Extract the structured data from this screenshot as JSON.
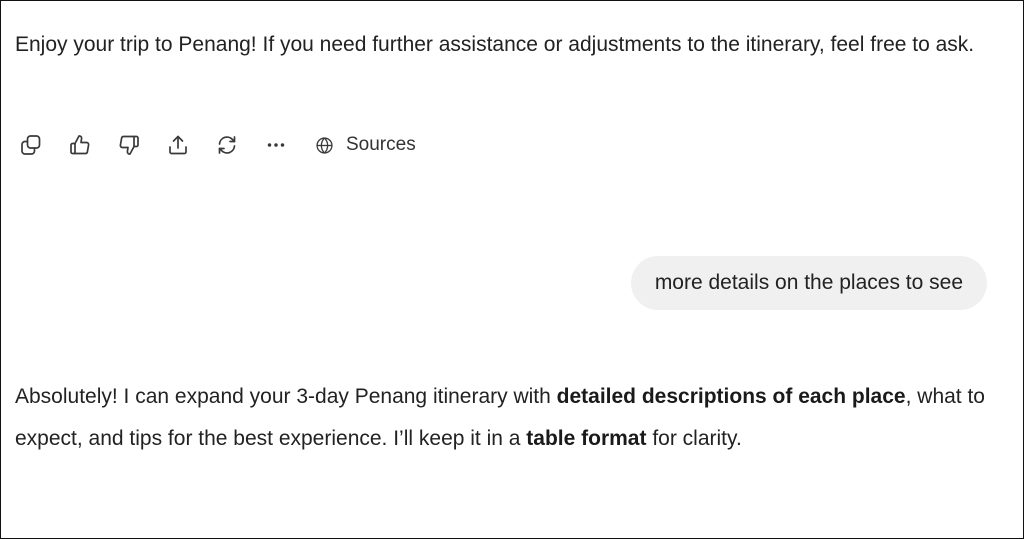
{
  "messages": [
    {
      "role": "assistant",
      "text": "Enjoy your trip to Penang! If you need further assistance or adjustments to the itinerary, feel free to ask."
    },
    {
      "role": "user",
      "text": "more details on the places to see"
    },
    {
      "role": "assistant",
      "segments": {
        "s1": "Absolutely! I can expand your 3-day Penang itinerary with ",
        "s2": "detailed descriptions of each place",
        "s3": ", what to expect, and tips for the best experience. I’ll keep it in a ",
        "s4": "table format",
        "s5": " for clarity."
      }
    }
  ],
  "actions": {
    "icons": [
      "copy-icon",
      "thumbs-up-icon",
      "thumbs-down-icon",
      "share-icon",
      "regenerate-icon",
      "more-icon",
      "globe-icon"
    ],
    "sources_label": "Sources"
  },
  "colors": {
    "text": "#222222",
    "bubble_bg": "#f0f0f0",
    "icon": "#3a3a3a",
    "border": "#111111"
  }
}
